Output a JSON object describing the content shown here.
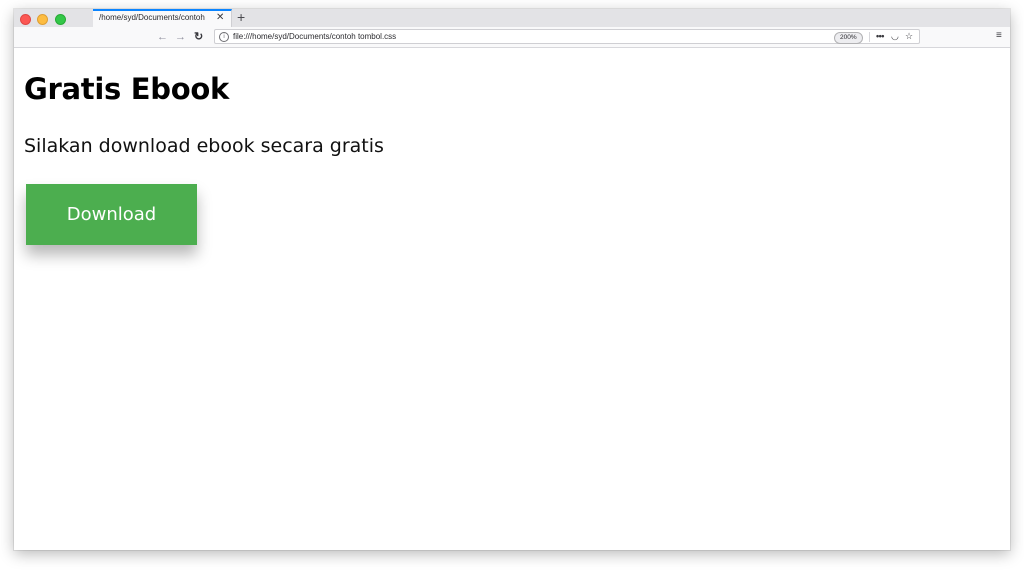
{
  "browser": {
    "tab_title": "/home/syd/Documents/contoh",
    "tab_close": "✕",
    "new_tab": "+",
    "nav": {
      "back": "←",
      "forward": "→",
      "reload": "↻"
    },
    "url": "file:///home/syd/Documents/contoh tombol.css",
    "zoom": "200%",
    "more": "•••",
    "pocket": "◡",
    "star": "☆",
    "menu": "≡",
    "info": "i"
  },
  "page": {
    "title": "Gratis Ebook",
    "subtitle": "Silakan download ebook secara gratis",
    "button_label": "Download",
    "button_color": "#4cae4f"
  }
}
